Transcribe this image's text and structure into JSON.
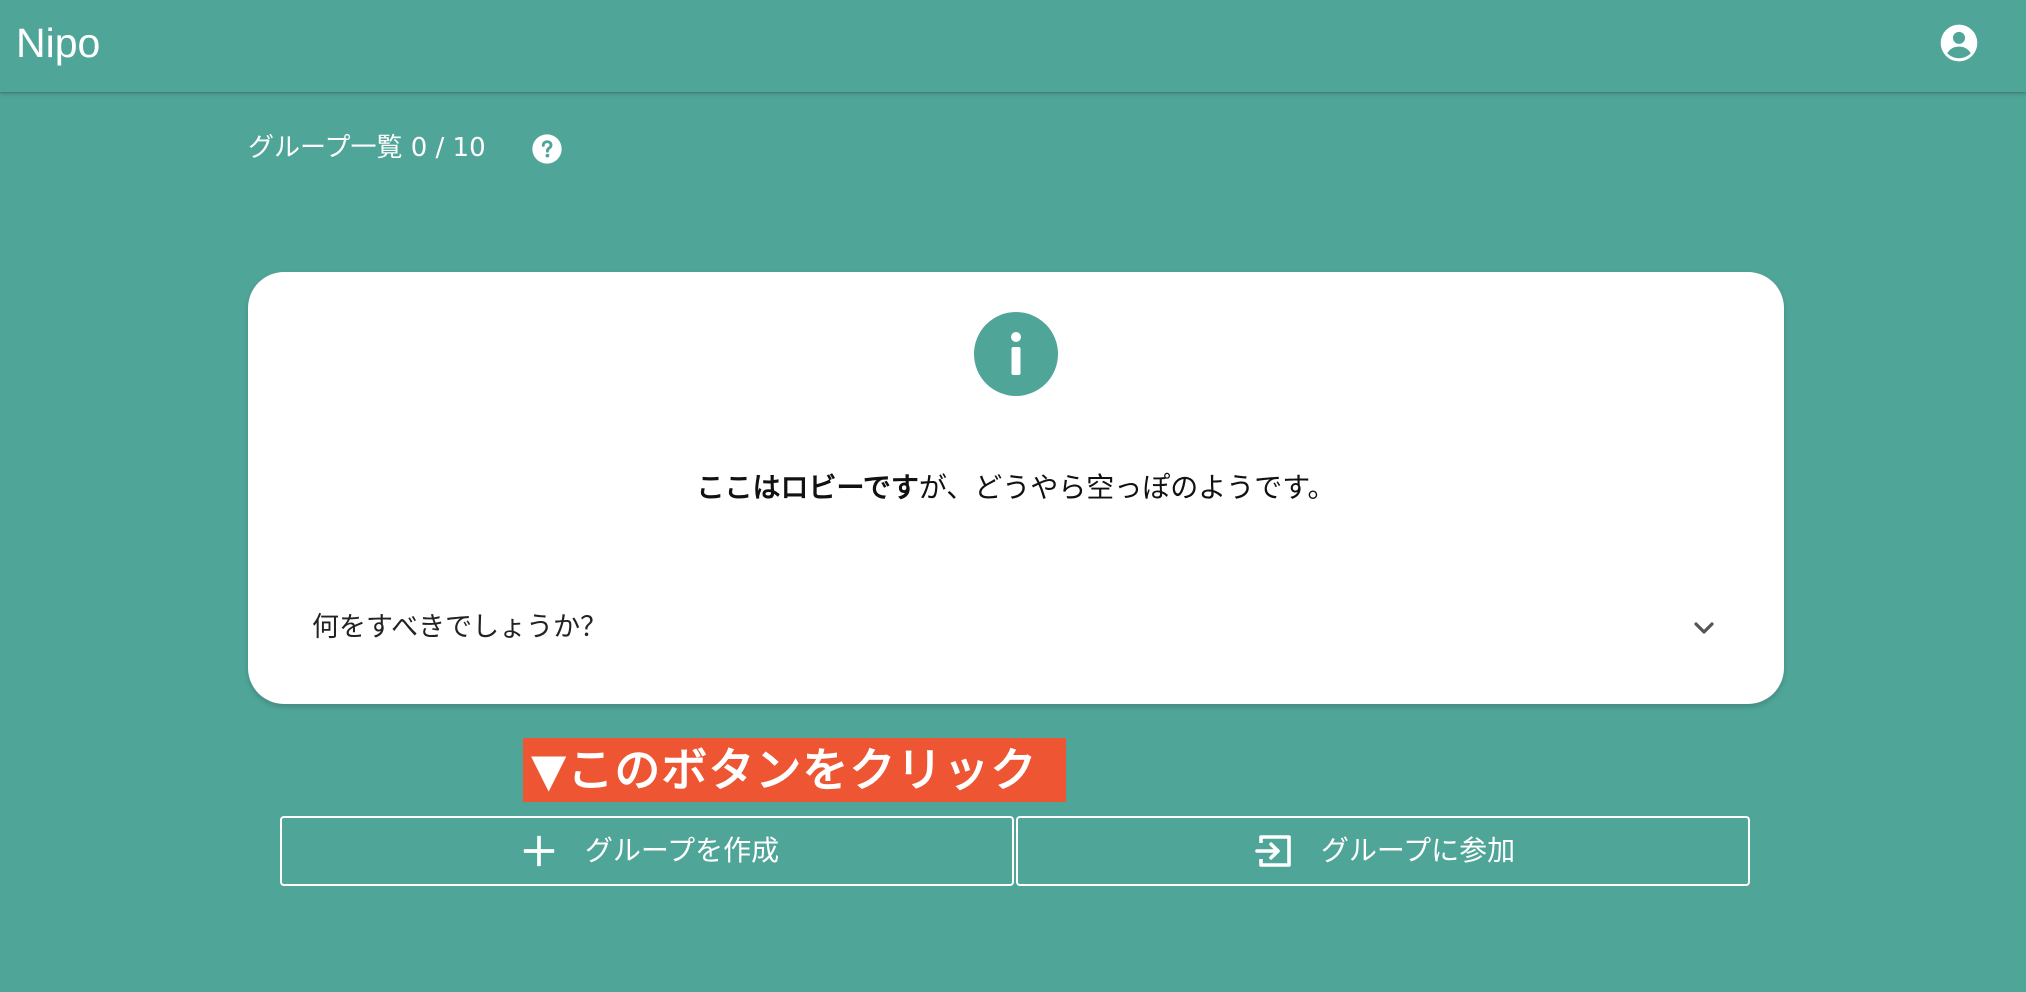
{
  "app": {
    "title": "Nipo"
  },
  "header": {
    "account_icon": "account-circle-icon"
  },
  "groups": {
    "label": "グループ一覧 0 / 10",
    "help_icon": "help-circle-icon"
  },
  "empty_card": {
    "icon": "info-icon",
    "message_bold": "ここはロビーです",
    "message_rest": "が、どうやら空っぽのようです。",
    "accordion_label": "何をすべきでしょうか？",
    "accordion_icon": "chevron-down-icon"
  },
  "callout": {
    "text": "▼このボタンをクリック",
    "color": "#ee5532"
  },
  "actions": {
    "create_label": "グループを作成",
    "create_icon": "plus-icon",
    "join_label": "グループに参加",
    "join_icon": "login-icon"
  },
  "colors": {
    "background": "#50a599",
    "card": "#ffffff",
    "accent": "#50a599"
  }
}
